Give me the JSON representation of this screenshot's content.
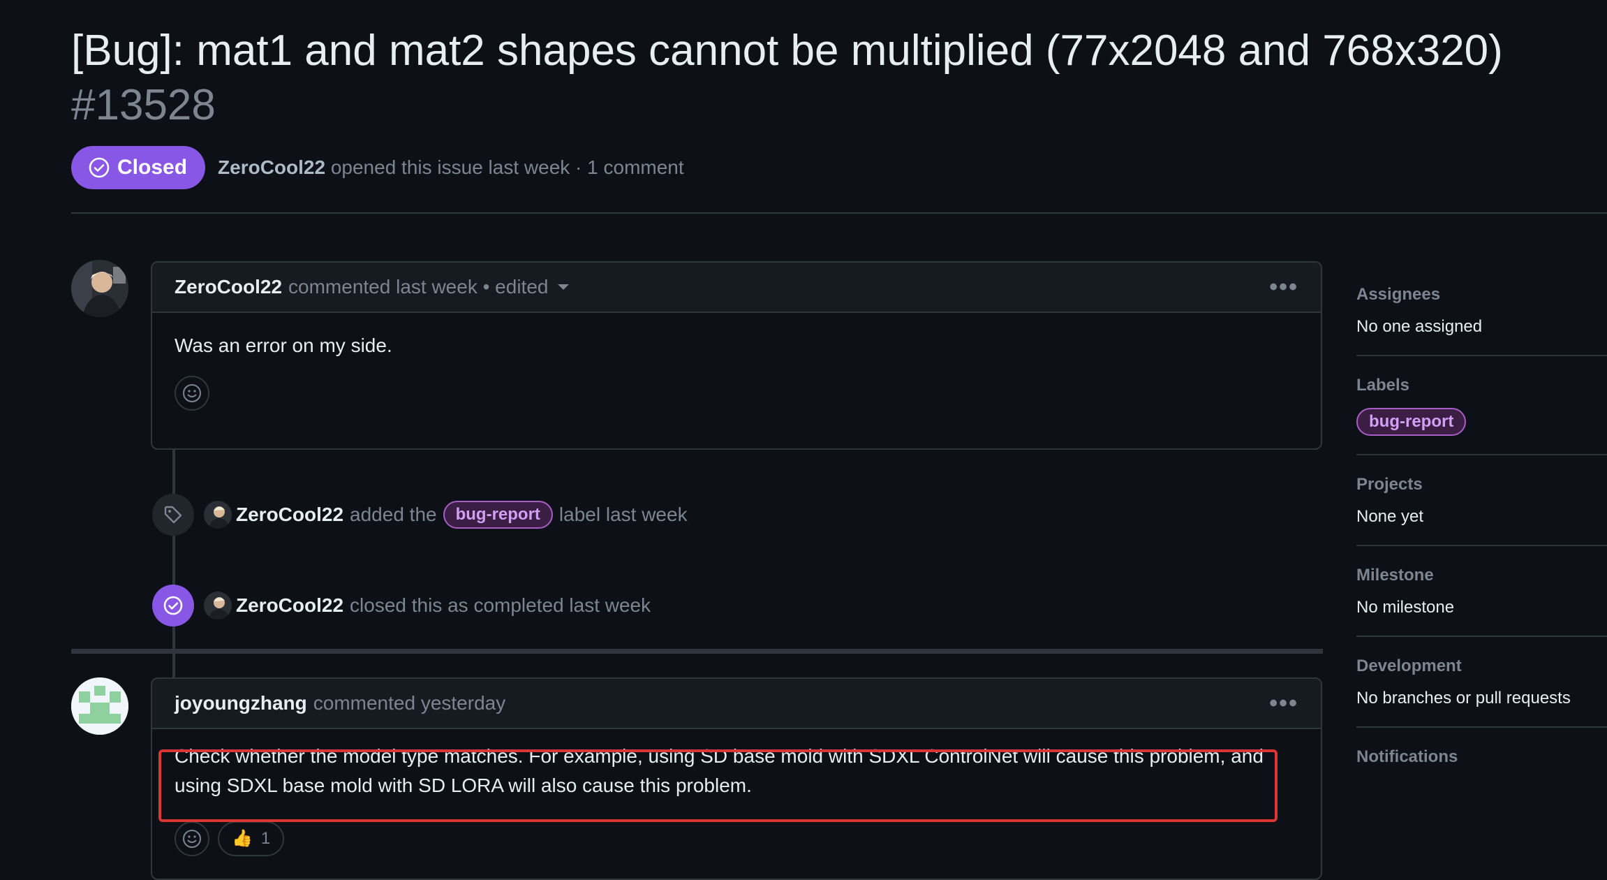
{
  "issue": {
    "title": "[Bug]: mat1 and mat2 shapes cannot be multiplied (77x2048 and 768x320)",
    "number": "#13528",
    "state": "Closed",
    "author": "ZeroCool22",
    "meta_rest": "opened this issue last week · 1 comment"
  },
  "comments": [
    {
      "author": "ZeroCool22",
      "header_rest": "commented last week • edited",
      "body": "Was an error on my side."
    },
    {
      "author": "joyoungzhang",
      "header_rest": "commented yesterday",
      "body": "Check whether the model type matches. For example, using SD base mold with SDXL ControlNet will cause this problem, and using SDXL base mold with SD LORA will also cause this problem.",
      "reaction_emoji": "👍",
      "reaction_count": "1"
    }
  ],
  "events": [
    {
      "actor": "ZeroCool22",
      "pre": "added the",
      "label": "bug-report",
      "post": "label last week"
    },
    {
      "actor": "ZeroCool22",
      "text": "closed this as completed last week"
    }
  ],
  "sidebar": {
    "assignees": {
      "heading": "Assignees",
      "value": "No one assigned"
    },
    "labels": {
      "heading": "Labels",
      "value": "bug-report"
    },
    "projects": {
      "heading": "Projects",
      "value": "None yet"
    },
    "milestone": {
      "heading": "Milestone",
      "value": "No milestone"
    },
    "development": {
      "heading": "Development",
      "value": "No branches or pull requests"
    },
    "notifications": {
      "heading": "Notifications"
    }
  },
  "colors": {
    "closed_badge": "#8957e5",
    "label_text": "#d29ff4",
    "highlight_border": "#da3633",
    "background": "#0d1117"
  },
  "icons": [
    "check-circle-icon",
    "kebab-horizontal-icon",
    "smiley-icon",
    "tag-icon",
    "caret-down-icon",
    "thumbs-up-icon"
  ]
}
